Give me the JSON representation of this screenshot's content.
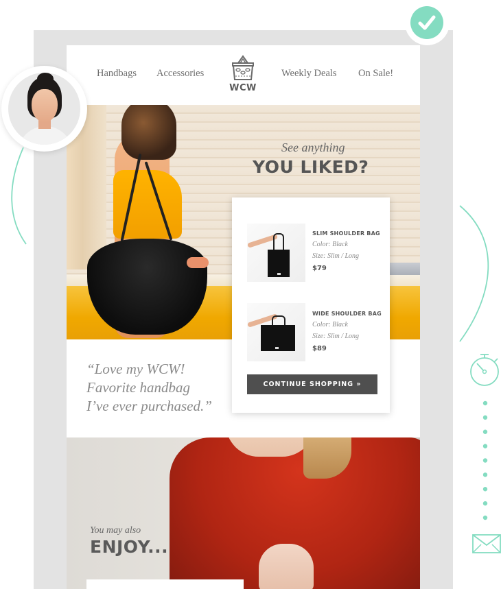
{
  "nav": {
    "left": [
      {
        "label": "Handbags"
      },
      {
        "label": "Accessories"
      }
    ],
    "right": [
      {
        "label": "Weekly Deals"
      },
      {
        "label": "On Sale!"
      }
    ],
    "logo_text": "WCW",
    "logo_icon": "basket-icon"
  },
  "hero": {
    "kicker": "See anything",
    "headline": "YOU LIKED?"
  },
  "products": [
    {
      "name": "SLIM SHOULDER BAG",
      "color": "Color: Black",
      "size": "Size: Slim / Long",
      "price": "$79"
    },
    {
      "name": "WIDE SHOULDER BAG",
      "color": "Color: Black",
      "size": "Size: Slim / Long",
      "price": "$89"
    }
  ],
  "cta": {
    "label": "CONTINUE SHOPPING »"
  },
  "testimonial": {
    "line1": "“Love my WCW!",
    "line2": "Favorite handbag",
    "line3": "I’ve ever purchased.”"
  },
  "recommend": {
    "kicker": "You may also",
    "headline": "ENJOY..."
  },
  "decorations": {
    "accent_color": "#84dcc1",
    "icons": [
      "check-icon",
      "stopwatch-icon",
      "envelope-icon"
    ],
    "dot_count": 9
  }
}
